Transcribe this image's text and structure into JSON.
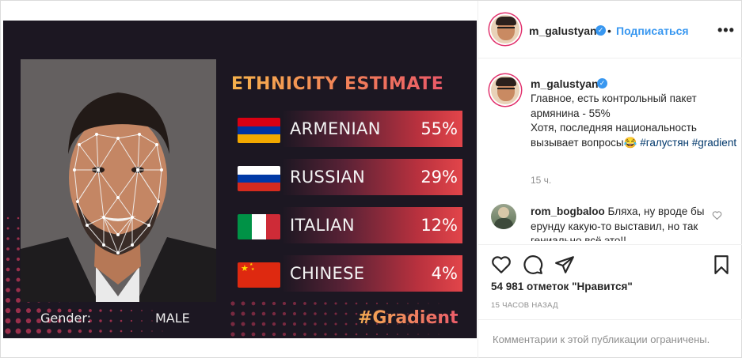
{
  "image": {
    "title": "ETHNICITY ESTIMATE",
    "rows": [
      {
        "label": "ARMENIAN",
        "value": "55%",
        "flag": "armenia-flag"
      },
      {
        "label": "RUSSIAN",
        "value": "29%",
        "flag": "russia-flag"
      },
      {
        "label": "ITALIAN",
        "value": "12%",
        "flag": "italy-flag"
      },
      {
        "label": "CHINESE",
        "value": "4%",
        "flag": "china-flag"
      }
    ],
    "gender_label": "Gender:",
    "gender_value": "MALE",
    "hashtag": "#Gradient"
  },
  "header": {
    "username": "m_galustyan",
    "separator": "•",
    "follow_label": "Подписаться",
    "more_label": "•••"
  },
  "caption": {
    "username": "m_galustyan",
    "line1": "Главное, есть контрольный пакет армянина - 55%",
    "line2": "Хотя, последняя национальность вызывает вопросы",
    "emoji": "😂",
    "hashtag1": "#галустян",
    "hashtag2": "#gradient",
    "time": "15 ч."
  },
  "comment": {
    "username": "rom_bogbaloo",
    "text": "Бляха, ну вроде бы ерунду какую-то выставил, но так гениально всё это!!"
  },
  "likes": "54 981 отметок \"Нравится\"",
  "posted_ago": "15 ЧАСОВ НАЗАД",
  "footer_notice": "Комментарии к этой публикации ограничены.",
  "colors": {
    "accent_blue": "#3897f0",
    "bar_red": "#e2454a",
    "image_bg": "#1c1722"
  }
}
